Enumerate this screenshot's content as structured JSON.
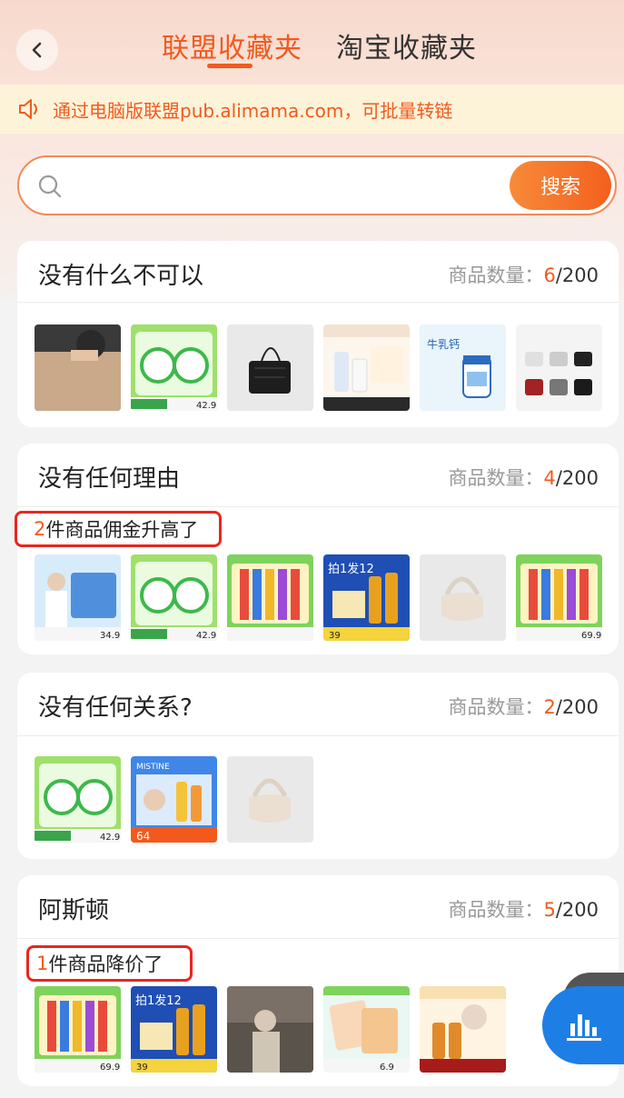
{
  "header": {
    "tabs": [
      {
        "label": "联盟收藏夹",
        "active": true
      },
      {
        "label": "淘宝收藏夹",
        "active": false
      }
    ]
  },
  "notice": {
    "text": "通过电脑版联盟pub.alimama.com，可批量转链"
  },
  "search": {
    "placeholder": "",
    "button_label": "搜索"
  },
  "count_label": "商品数量：",
  "folders": [
    {
      "title": "没有什么不可以",
      "count": "6",
      "total": "/200",
      "alert": null,
      "thumbs": [
        "sweater-photo",
        "tissue-pack",
        "black-bag",
        "aveeno-lotion",
        "milk-calcium",
        "bag-collection"
      ],
      "thumb_texts": {
        "price_1": "42.9",
        "milk": "牛乳钙"
      }
    },
    {
      "title": "没有任何理由",
      "count": "4",
      "total": "/200",
      "alert": {
        "count": "2",
        "text": "件商品佣金升高了"
      },
      "thumbs": [
        "wipes-pack",
        "tissue-pack",
        "toothbrush-set",
        "shampoo-set",
        "cream-bag",
        "toothbrush-set"
      ],
      "thumb_texts": {
        "price_0": "34.9",
        "price_1": "42.9",
        "price_3": "39",
        "price_5": "69.9",
        "badge_3": "拍1发12"
      }
    },
    {
      "title": "没有任何关系?",
      "count": "2",
      "total": "/200",
      "alert": null,
      "thumbs": [
        "tissue-pack",
        "sunscreen",
        "cream-bag"
      ],
      "thumb_texts": {
        "price_0": "42.9",
        "price_1": "64",
        "brand_1": "MISTINE"
      }
    },
    {
      "title": "阿斯顿",
      "count": "5",
      "total": "/200",
      "alert": {
        "count": "1",
        "text": "件商品降价了"
      },
      "thumbs": [
        "toothbrush-set",
        "shampoo-set",
        "person-photo",
        "mask-pack",
        "liquor-set"
      ],
      "thumb_texts": {
        "price_0": "69.9",
        "price_1": "39",
        "price_3": "6.9",
        "badge_1": "拍1发12"
      }
    }
  ],
  "colors": {
    "accent": "#f25a1d",
    "alert_border": "#e8271f",
    "notice_bg": "#fdf3d9",
    "fab": "#1d7fe6"
  }
}
